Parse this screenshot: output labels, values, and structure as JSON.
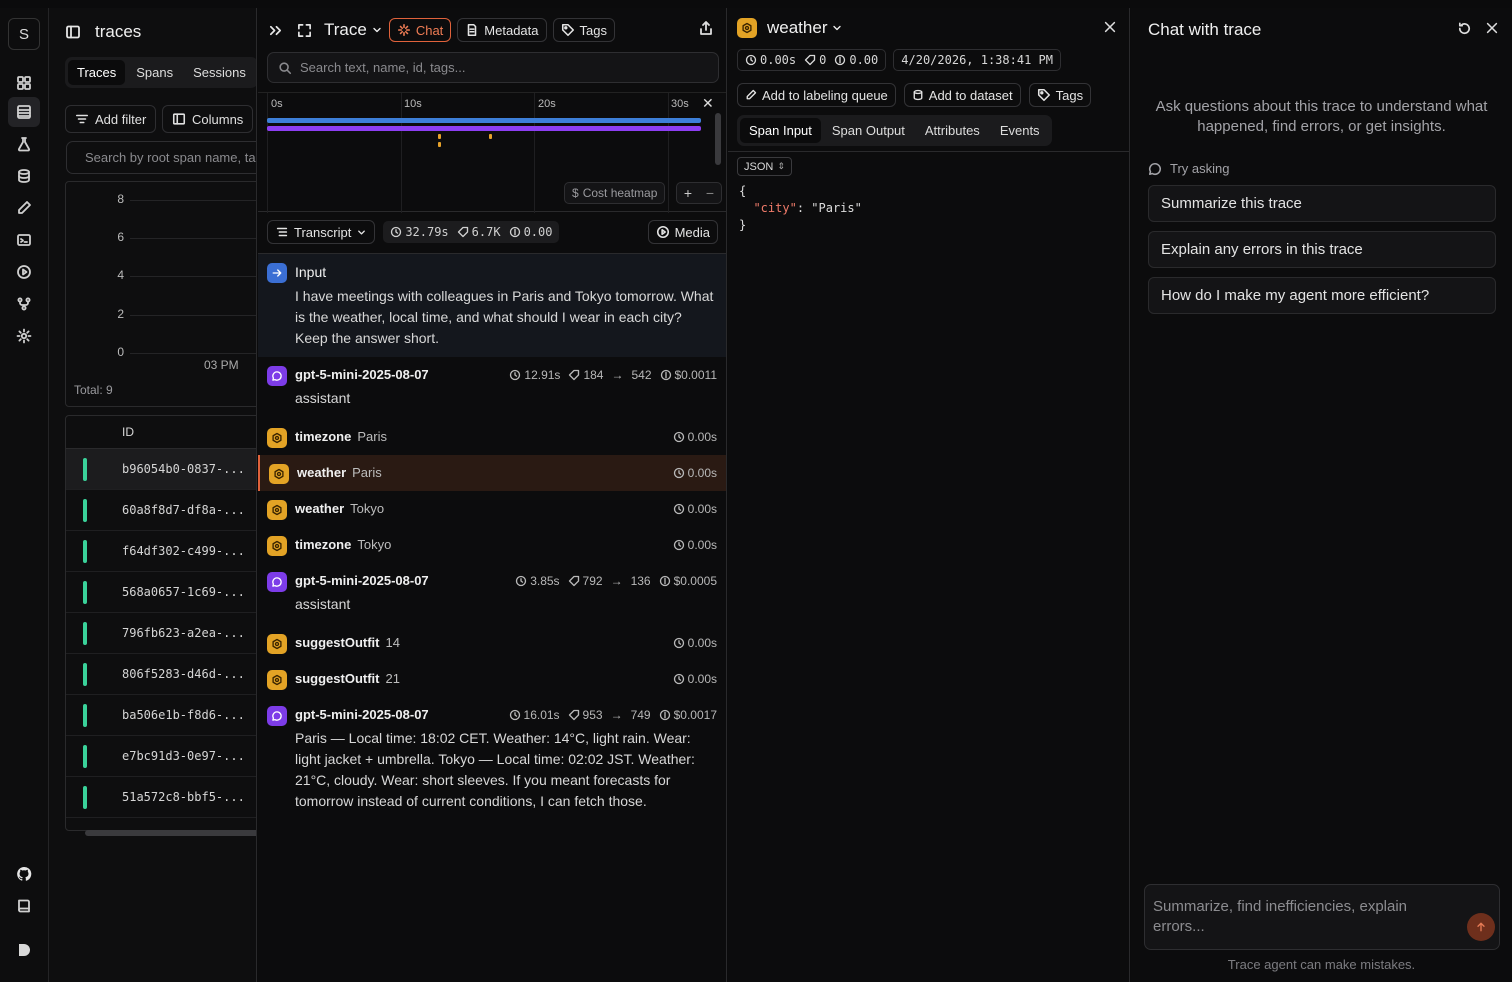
{
  "rail": {
    "logo": "S",
    "icons": [
      "dashboard-icon",
      "traces-icon",
      "experiments-icon",
      "datasets-icon",
      "prompts-icon",
      "playground-icon",
      "sessions-icon",
      "graph-icon",
      "settings-icon",
      "github-icon",
      "docs-icon",
      "theme-icon"
    ]
  },
  "traces": {
    "title": "traces",
    "tabs": [
      "Traces",
      "Spans",
      "Sessions"
    ],
    "add_filter": "Add filter",
    "columns": "Columns",
    "search_placeholder": "Search by root span name, tags...",
    "chart": {
      "yticks": [
        "8",
        "6",
        "4",
        "2",
        "0"
      ],
      "xtick": "03 PM",
      "total": "Total: 9"
    },
    "table_header": "ID",
    "rows": [
      "b96054b0-0837-...",
      "60a8f8d7-df8a-...",
      "f64df302-c499-...",
      "568a0657-1c69-...",
      "796fb623-a2ea-...",
      "806f5283-d46d-...",
      "ba506e1b-f8d6-...",
      "e7bc91d3-0e97-...",
      "51a572c8-bbf5-..."
    ],
    "selected_row": 0,
    "status_color": "#3ad29a"
  },
  "trace": {
    "title": "Trace",
    "chat_label": "Chat",
    "metadata_label": "Metadata",
    "tags_label": "Tags",
    "search_placeholder": "Search text, name, id, tags...",
    "ticks": [
      "0s",
      "10s",
      "20s",
      "30s"
    ],
    "cost_heatmap": "Cost heatmap",
    "zoom_in": "+",
    "zoom_out": "−",
    "view_mode": "Transcript",
    "stats": {
      "duration": "32.79s",
      "tokens": "6.7K",
      "cost": "0.00"
    },
    "media_label": "Media",
    "input": {
      "label": "Input",
      "text": "I have meetings with colleagues in Paris and Tokyo tomorrow. What is the weather, local time, and what should I wear in each city? Keep the answer short."
    },
    "spans": [
      {
        "kind": "llm",
        "name": "gpt-5-mini-2025-08-07",
        "time": "12.91s",
        "tok_in": "184",
        "tok_out": "542",
        "cost": "$0.0011",
        "body": "assistant"
      },
      {
        "kind": "tool",
        "name": "timezone",
        "arg": "Paris",
        "time": "0.00s"
      },
      {
        "kind": "tool",
        "name": "weather",
        "arg": "Paris",
        "time": "0.00s",
        "selected": true
      },
      {
        "kind": "tool",
        "name": "weather",
        "arg": "Tokyo",
        "time": "0.00s"
      },
      {
        "kind": "tool",
        "name": "timezone",
        "arg": "Tokyo",
        "time": "0.00s"
      },
      {
        "kind": "llm",
        "name": "gpt-5-mini-2025-08-07",
        "time": "3.85s",
        "tok_in": "792",
        "tok_out": "136",
        "cost": "$0.0005",
        "body": "assistant"
      },
      {
        "kind": "tool",
        "name": "suggestOutfit",
        "arg": "14",
        "time": "0.00s"
      },
      {
        "kind": "tool",
        "name": "suggestOutfit",
        "arg": "21",
        "time": "0.00s"
      },
      {
        "kind": "llm",
        "name": "gpt-5-mini-2025-08-07",
        "time": "16.01s",
        "tok_in": "953",
        "tok_out": "749",
        "cost": "$0.0017",
        "body": "Paris — Local time: 18:02 CET. Weather: 14°C, light rain. Wear: light jacket + umbrella. Tokyo — Local time: 02:02 JST. Weather: 21°C, cloudy. Wear: short sleeves. If you meant forecasts for tomorrow instead of current conditions, I can fetch those."
      }
    ],
    "colors": {
      "accent": "#e0623b",
      "llm": "#7d3ce8",
      "tool": "#e3a325",
      "input": "#3b6fd4",
      "bar_trace": "#3d7fd8",
      "bar_llm": "#8c3ef2"
    }
  },
  "span": {
    "name": "weather",
    "duration": "0.00s",
    "tokens": "0",
    "cost": "0.00",
    "timestamp": "4/20/2026, 1:38:41 PM",
    "labeling_queue": "Add to labeling queue",
    "dataset": "Add to dataset",
    "tags": "Tags",
    "tabs": [
      "Span Input",
      "Span Output",
      "Attributes",
      "Events"
    ],
    "format": "JSON",
    "json_key": "\"city\"",
    "json_value": "\"Paris\""
  },
  "chat": {
    "title": "Chat with trace",
    "intro": "Ask questions about this trace to understand what happened, find errors, or get insights.",
    "try_asking": "Try asking",
    "suggestions": [
      "Summarize this trace",
      "Explain any errors in this trace",
      "How do I make my agent more efficient?"
    ],
    "placeholder": "Summarize, find inefficiencies, explain errors...",
    "disclaimer": "Trace agent can make mistakes."
  }
}
